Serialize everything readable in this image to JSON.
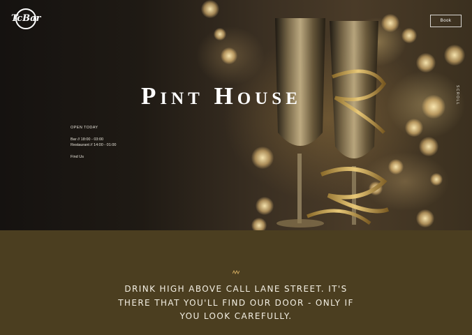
{
  "header": {
    "logo_text": "TcBar",
    "book_label": "Book"
  },
  "hero": {
    "title": "Pint House",
    "scroll_label": "SCROLL"
  },
  "hours": {
    "title": "OPEN TODAY",
    "bar": "Bar // 18:00 - 03:00",
    "restaurant": "Restaurant // 14:00 - 01:00",
    "find_us": "Find Us"
  },
  "intro": {
    "wave_icon": "wave-icon",
    "tagline": "DRINK HIGH ABOVE CALL LANE STREET. IT'S THERE THAT YOU'LL FIND OUR DOOR - ONLY IF YOU LOOK CAREFULLY."
  },
  "colors": {
    "band": "#4b3e20",
    "accent_gold": "#c9a45c"
  }
}
